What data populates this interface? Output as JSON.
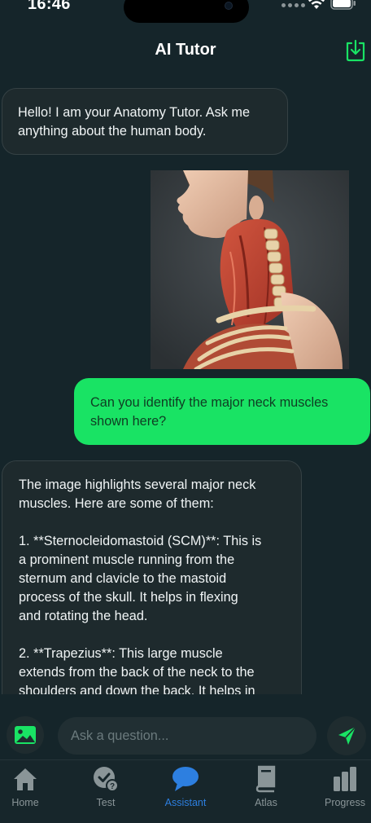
{
  "status_bar": {
    "time": "16:46"
  },
  "header": {
    "title": "AI Tutor"
  },
  "messages": [
    {
      "role": "ai",
      "lines": [
        "Hello! I am your Anatomy Tutor. Ask me",
        "anything about the human body."
      ]
    },
    {
      "role": "user",
      "type": "image",
      "image": "neck-muscles-anatomy-illustration"
    },
    {
      "role": "user",
      "lines": [
        "Can you identify the major neck muscles",
        "shown here?"
      ]
    },
    {
      "role": "ai",
      "lines": [
        "The image highlights several major neck",
        "muscles. Here are some of them:",
        "",
        "1. **Sternocleidomastoid (SCM)**: This is",
        "a prominent muscle running from the",
        "sternum and clavicle to the mastoid",
        "process of the skull. It helps in flexing",
        "and rotating the head.",
        "",
        "2. **Trapezius**: This large muscle",
        "extends from the back of the neck to the",
        "shoulders and down the back. It helps in"
      ]
    }
  ],
  "input": {
    "placeholder": "Ask a question..."
  },
  "tabs": [
    {
      "label": "Home",
      "icon": "home-icon",
      "active": false
    },
    {
      "label": "Test",
      "icon": "test-check-icon",
      "active": false
    },
    {
      "label": "Assistant",
      "icon": "chat-bubble-icon",
      "active": true
    },
    {
      "label": "Atlas",
      "icon": "book-icon",
      "active": false
    },
    {
      "label": "Progress",
      "icon": "bar-chart-icon",
      "active": false
    }
  ],
  "colors": {
    "background": "#15252a",
    "accent_green": "#19e364",
    "accent_blue": "#2d7fe0",
    "bubble_ai": "#1e2a2d"
  }
}
